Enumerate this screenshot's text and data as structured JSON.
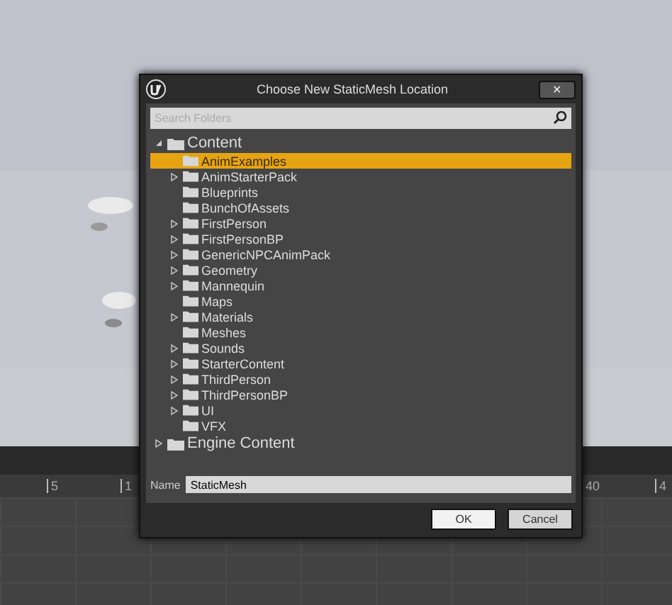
{
  "ruler": {
    "ticks": [
      "5",
      "1",
      "40",
      "4"
    ]
  },
  "dialog": {
    "title": "Choose New StaticMesh Location",
    "close": "✕",
    "search": {
      "placeholder": "Search Folders"
    },
    "tree": [
      {
        "label": "Content",
        "expandable": true,
        "expanded": true,
        "selected": false,
        "children": [
          {
            "label": "AnimExamples",
            "expandable": false,
            "selected": true
          },
          {
            "label": "AnimStarterPack",
            "expandable": true,
            "selected": false
          },
          {
            "label": "Blueprints",
            "expandable": false,
            "selected": false
          },
          {
            "label": "BunchOfAssets",
            "expandable": false,
            "selected": false
          },
          {
            "label": "FirstPerson",
            "expandable": true,
            "selected": false
          },
          {
            "label": "FirstPersonBP",
            "expandable": true,
            "selected": false
          },
          {
            "label": "GenericNPCAnimPack",
            "expandable": true,
            "selected": false
          },
          {
            "label": "Geometry",
            "expandable": true,
            "selected": false
          },
          {
            "label": "Mannequin",
            "expandable": true,
            "selected": false
          },
          {
            "label": "Maps",
            "expandable": false,
            "selected": false
          },
          {
            "label": "Materials",
            "expandable": true,
            "selected": false
          },
          {
            "label": "Meshes",
            "expandable": false,
            "selected": false
          },
          {
            "label": "Sounds",
            "expandable": true,
            "selected": false
          },
          {
            "label": "StarterContent",
            "expandable": true,
            "selected": false
          },
          {
            "label": "ThirdPerson",
            "expandable": true,
            "selected": false
          },
          {
            "label": "ThirdPersonBP",
            "expandable": true,
            "selected": false
          },
          {
            "label": "UI",
            "expandable": true,
            "selected": false
          },
          {
            "label": "VFX",
            "expandable": false,
            "selected": false
          }
        ]
      },
      {
        "label": "Engine Content",
        "expandable": true,
        "expanded": false,
        "selected": false
      }
    ],
    "name_label": "Name",
    "name_value": "StaticMesh",
    "buttons": [
      {
        "label": "OK",
        "hovered": true
      },
      {
        "label": "Cancel",
        "hovered": false
      }
    ]
  }
}
